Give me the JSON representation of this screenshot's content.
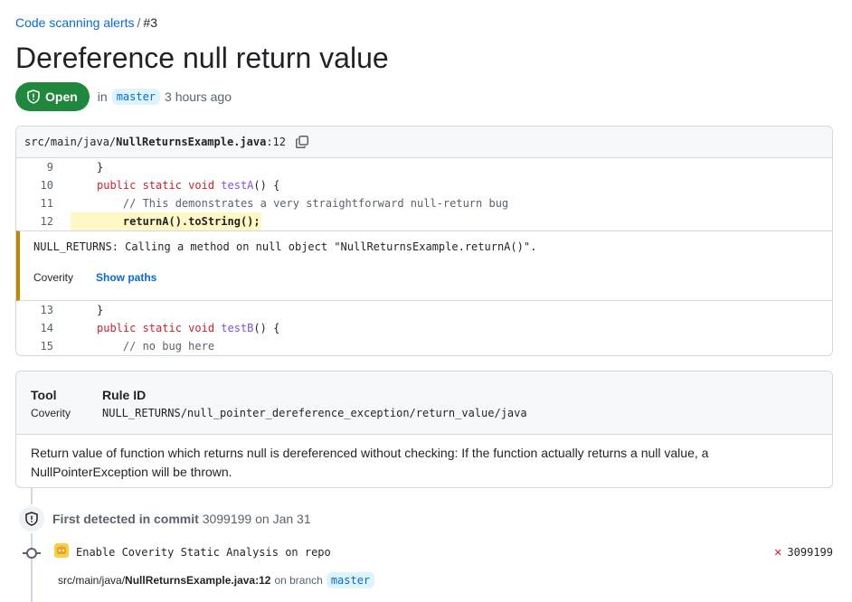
{
  "breadcrumb": {
    "parent": "Code scanning alerts",
    "separator": "/",
    "current": "#3"
  },
  "title": "Dereference null return value",
  "status": {
    "badge": "Open",
    "in": "in",
    "branch": "master",
    "time": "3 hours ago",
    "badge_color": "#1f883d"
  },
  "code": {
    "file_path": "src/main/java/",
    "file_name": "NullReturnsExample.java",
    "line_ref": ":12",
    "lines_before": [
      {
        "num": "9",
        "indent": "",
        "parts": [
          {
            "t": "}",
            "c": ""
          }
        ]
      },
      {
        "num": "10",
        "indent": "",
        "parts": [
          {
            "t": "public static void ",
            "c": "kw"
          },
          {
            "t": "testA",
            "c": "fn"
          },
          {
            "t": "() {",
            "c": ""
          }
        ]
      },
      {
        "num": "11",
        "indent": "    ",
        "parts": [
          {
            "t": "// This demonstrates a very straightforward null-return bug",
            "c": "cm"
          }
        ]
      },
      {
        "num": "12",
        "indent": "    ",
        "parts": [
          {
            "t": "returnA().toString();",
            "c": "hl"
          }
        ]
      }
    ],
    "message": "NULL_RETURNS: Calling a method on null object \"NullReturnsExample.returnA()\".",
    "message_tool": "Coverity",
    "show_paths": "Show paths",
    "lines_after": [
      {
        "num": "13",
        "indent": "",
        "parts": [
          {
            "t": "}",
            "c": ""
          }
        ]
      },
      {
        "num": "14",
        "indent": "",
        "parts": [
          {
            "t": "public static void ",
            "c": "kw"
          },
          {
            "t": "testB",
            "c": "fn"
          },
          {
            "t": "() {",
            "c": ""
          }
        ]
      },
      {
        "num": "15",
        "indent": "    ",
        "parts": [
          {
            "t": "// no bug here",
            "c": "cm"
          }
        ]
      }
    ],
    "highlight_color": "#fff8c5",
    "message_accent": "#bf8700"
  },
  "info": {
    "tool_label": "Tool",
    "tool_value": "Coverity",
    "rule_label": "Rule ID",
    "rule_value": "NULL_RETURNS/null_pointer_dereference_exception/return_value/java",
    "description": "Return value of function which returns null is dereferenced without checking: If the function actually returns a null value, a NullPointerException will be thrown."
  },
  "timeline": {
    "first_detected_label": "First detected in commit",
    "first_detected_commit": "3099199",
    "first_detected_date": "on Jan 31",
    "commit_message": "Enable Coverity Static Analysis on repo",
    "commit_sha": "3099199",
    "loc_path": "src/main/java/",
    "loc_file": "NullReturnsExample.java:12",
    "loc_on_branch": "on branch",
    "loc_branch": "master"
  }
}
